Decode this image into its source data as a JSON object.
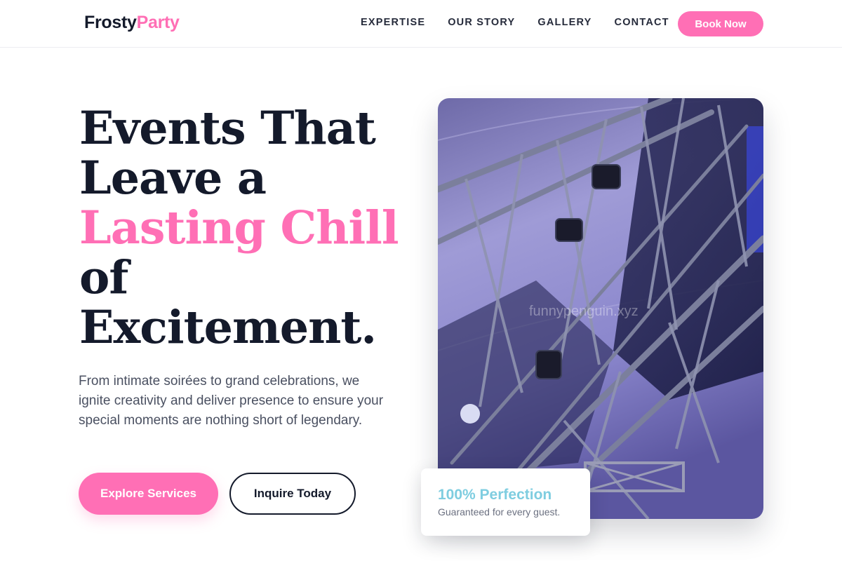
{
  "brand": {
    "name_part1": "Frosty",
    "name_part2": "Party"
  },
  "nav": {
    "items": [
      {
        "label": "EXPERTISE"
      },
      {
        "label": "OUR STORY"
      },
      {
        "label": "GALLERY"
      },
      {
        "label": "CONTACT"
      }
    ],
    "cta_label": "Book Now"
  },
  "hero": {
    "headline_line1": "Events That",
    "headline_line2": "Leave a",
    "headline_highlight": "Lasting Chill",
    "headline_line4": "of",
    "headline_line5": "Excitement.",
    "subtext": "From intimate soirées to grand celebrations, we ignite creativity and deliver presence to ensure your special moments are nothing short of legendary.",
    "primary_button": "Explore Services",
    "secondary_button": "Inquire Today"
  },
  "image": {
    "watermark": "funnypenguin.xyz"
  },
  "badge": {
    "title": "100% Perfection",
    "subtitle": "Guaranteed for every guest."
  },
  "colors": {
    "accent": "#ff6fb5",
    "dark": "#141a2b",
    "teal": "#7ecde0"
  }
}
